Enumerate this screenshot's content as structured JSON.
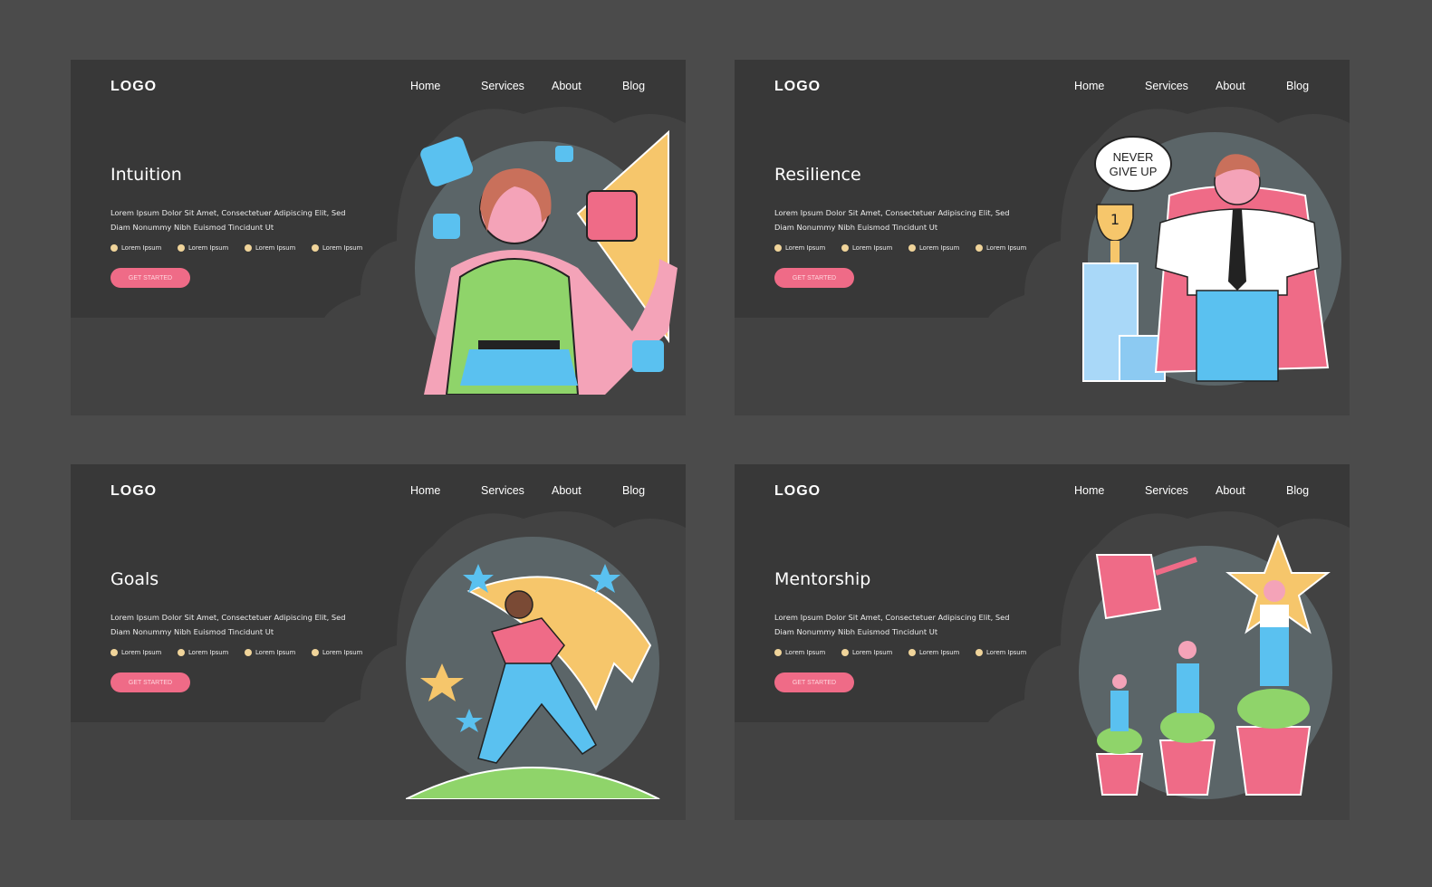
{
  "colors": {
    "page_bg": "#4b4b4b",
    "panel_bg": "#424242",
    "panel_dark": "#383838",
    "accent": "#ef6b87",
    "bullet": "#f0d49a",
    "circle": "#5b6568"
  },
  "panels": [
    {
      "logo": "LOGO",
      "nav": [
        "Home",
        "Services",
        "About",
        "Blog"
      ],
      "title": "Intuition",
      "desc": "Lorem Ipsum Dolor Sit Amet, Consectetuer Adipiscing Elit, Sed Diam Nonummy Nibh Euismod Tincidunt Ut",
      "bullets": [
        "Lorem Ipsum",
        "Lorem Ipsum",
        "Lorem Ipsum",
        "Lorem Ipsum"
      ],
      "button": "GET STARTED",
      "illustration": "woman-puzzle-intuition"
    },
    {
      "logo": "LOGO",
      "nav": [
        "Home",
        "Services",
        "About",
        "Blog"
      ],
      "title": "Resilience",
      "desc": "Lorem Ipsum Dolor Sit Amet, Consectetuer Adipiscing Elit, Sed Diam Nonummy Nibh Euismod Tincidunt Ut",
      "bullets": [
        "Lorem Ipsum",
        "Lorem Ipsum",
        "Lorem Ipsum",
        "Lorem Ipsum"
      ],
      "button": "GET STARTED",
      "illustration": "man-cape-trophy",
      "speech_bubble": [
        "NEVER",
        "GIVE UP"
      ],
      "trophy_number": "1"
    },
    {
      "logo": "LOGO",
      "nav": [
        "Home",
        "Services",
        "About",
        "Blog"
      ],
      "title": "Goals",
      "desc": "Lorem Ipsum Dolor Sit Amet, Consectetuer Adipiscing Elit, Sed Diam Nonummy Nibh Euismod Tincidunt Ut",
      "bullets": [
        "Lorem Ipsum",
        "Lorem Ipsum",
        "Lorem Ipsum",
        "Lorem Ipsum"
      ],
      "button": "GET STARTED",
      "illustration": "man-running-shooting-star"
    },
    {
      "logo": "LOGO",
      "nav": [
        "Home",
        "Services",
        "About",
        "Blog"
      ],
      "title": "Mentorship",
      "desc": "Lorem Ipsum Dolor Sit Amet, Consectetuer Adipiscing Elit, Sed Diam Nonummy Nibh Euismod Tincidunt Ut",
      "bullets": [
        "Lorem Ipsum",
        "Lorem Ipsum",
        "Lorem Ipsum",
        "Lorem Ipsum"
      ],
      "button": "GET STARTED",
      "illustration": "women-growing-plants-watering-can"
    }
  ]
}
